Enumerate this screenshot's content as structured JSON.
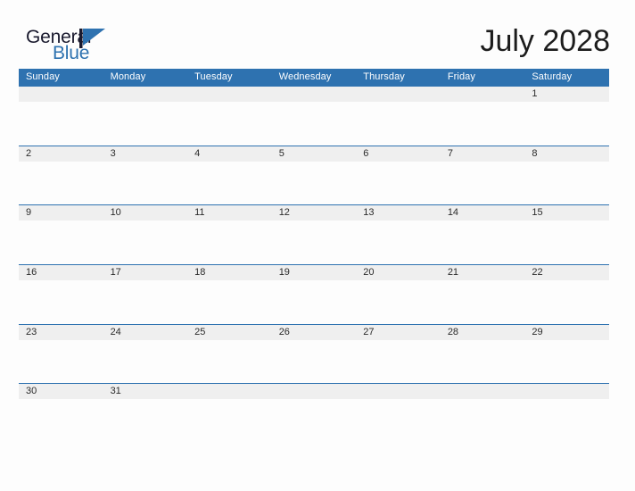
{
  "brand": {
    "name_part1": "General",
    "name_part2": "Blue",
    "flag_icon": "blue-triangle-flag-icon",
    "color_dark": "#1a1a2e",
    "color_blue": "#2e72b0"
  },
  "header": {
    "title": "July 2028",
    "month": "July",
    "year": "2028"
  },
  "theme": {
    "header_blue": "#2e72b0",
    "row_band_gray": "#efefef",
    "page_background": "#fdfdfd",
    "grid_line_blue": "#2e72b0",
    "date_text": "#2b2b2b",
    "weekday_text": "#ffffff"
  },
  "calendar": {
    "weekday_headers": [
      "Sunday",
      "Monday",
      "Tuesday",
      "Wednesday",
      "Thursday",
      "Friday",
      "Saturday"
    ],
    "weeks": [
      [
        "",
        "",
        "",
        "",
        "",
        "",
        "1"
      ],
      [
        "2",
        "3",
        "4",
        "5",
        "6",
        "7",
        "8"
      ],
      [
        "9",
        "10",
        "11",
        "12",
        "13",
        "14",
        "15"
      ],
      [
        "16",
        "17",
        "18",
        "19",
        "20",
        "21",
        "22"
      ],
      [
        "23",
        "24",
        "25",
        "26",
        "27",
        "28",
        "29"
      ],
      [
        "30",
        "31",
        "",
        "",
        "",
        "",
        ""
      ]
    ]
  }
}
